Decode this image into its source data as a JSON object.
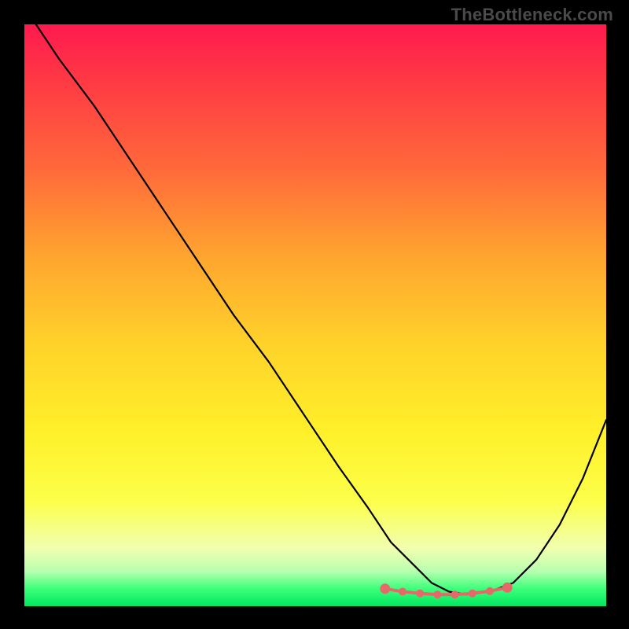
{
  "watermark": "TheBottleneck.com",
  "colors": {
    "frame": "#000000",
    "curve": "#000000",
    "marker": "#e46a6a",
    "gradient_top": "#ff1a4f",
    "gradient_bottom": "#00e860"
  },
  "chart_data": {
    "type": "line",
    "title": "",
    "xlabel": "",
    "ylabel": "",
    "xlim": [
      0,
      100
    ],
    "ylim": [
      0,
      100
    ],
    "note": "Axes are unmarked; values are normalized 0–100 by pixel position (y=0 at bottom, y=100 at top).",
    "series": [
      {
        "name": "bottleneck-curve",
        "x": [
          2,
          6,
          12,
          18,
          24,
          30,
          36,
          42,
          48,
          54,
          59,
          63,
          67,
          70,
          73,
          76,
          80,
          84,
          88,
          92,
          96,
          100
        ],
        "y": [
          100,
          94,
          86,
          77,
          68,
          59,
          50,
          42,
          33,
          24,
          17,
          11,
          7,
          4,
          2.5,
          2,
          2.5,
          4,
          8,
          14,
          22,
          32
        ]
      }
    ],
    "markers": {
      "name": "highlighted-points",
      "x": [
        62,
        65,
        68,
        71,
        74,
        77,
        80,
        83
      ],
      "y": [
        3.0,
        2.5,
        2.2,
        2.0,
        2.0,
        2.2,
        2.6,
        3.2
      ]
    }
  }
}
